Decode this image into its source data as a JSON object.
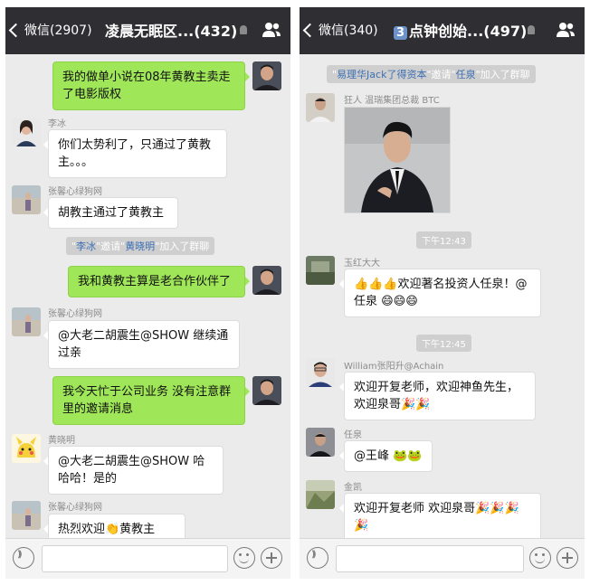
{
  "left": {
    "nav": {
      "back_label": "微信(2907)",
      "title": "凌晨无眠区...(432)"
    },
    "system": {
      "prefix": "\"",
      "user1": "李冰",
      "mid": "\"邀请\"",
      "user2": "黄晓明",
      "suffix": "\"加入了群聊"
    },
    "messages": [
      {
        "sender": "",
        "text": "我的做单小说在08年黄教主卖走了电影版权",
        "direction": "out"
      },
      {
        "sender": "李冰",
        "text": "你们太势利了，只通过了黄教主。。。",
        "direction": "in"
      },
      {
        "sender": "张馨心绿狗网",
        "text": "胡教主通过了黄教主",
        "direction": "in"
      },
      {
        "sender": "",
        "text": "我和黄教主算是老合作伙伴了",
        "direction": "out"
      },
      {
        "sender": "张馨心绿狗网",
        "text": "@大老二胡震生@SHOW 继续通过亲",
        "direction": "in"
      },
      {
        "sender": "",
        "text": "我今天忙于公司业务 没有注意群里的邀请消息",
        "direction": "out"
      },
      {
        "sender": "黄晓明",
        "text": "@大老二胡震生@SHOW 哈哈哈！是的",
        "direction": "in"
      },
      {
        "sender": "张馨心绿狗网",
        "text": "热烈欢迎👏黄教主",
        "direction": "in"
      }
    ]
  },
  "right": {
    "nav": {
      "back_label": "微信(340)",
      "badge": "3",
      "title": "点钟创始...(497)"
    },
    "system": {
      "prefix": "\"",
      "user1": "易理华Jack了得资本",
      "mid": "\"邀请\"",
      "user2": "任泉",
      "suffix": "\"加入了群聊"
    },
    "photo_sender": "狂人 温瑞集团总裁 BTC",
    "times": [
      "下午12:43",
      "下午12:45"
    ],
    "messages": [
      {
        "sender": "玉红大大",
        "text": "👍👍👍欢迎著名投资人任泉！@任泉 😄😄😄",
        "direction": "in"
      },
      {
        "sender": "William张阳升@Achain",
        "text": "欢迎开复老师，欢迎神鱼先生，欢迎泉哥🎉🎉",
        "direction": "in"
      },
      {
        "sender": "任泉",
        "text": "@王峰 🐸🐸",
        "direction": "in"
      },
      {
        "sender": "金凯",
        "text": "欢迎开复老师 欢迎泉哥🎉🎉🎉🎉",
        "direction": "in"
      }
    ]
  },
  "colors": {
    "nav_bg": "#2f2f33",
    "chat_bg": "#ebebeb",
    "out_bubble": "#9fe658",
    "in_bubble": "#ffffff",
    "mention": "#3c6fb3"
  },
  "icons": [
    "chevron-left-icon",
    "mute-bell-icon",
    "group-members-icon",
    "voice-icon",
    "emoji-icon",
    "plus-icon"
  ]
}
